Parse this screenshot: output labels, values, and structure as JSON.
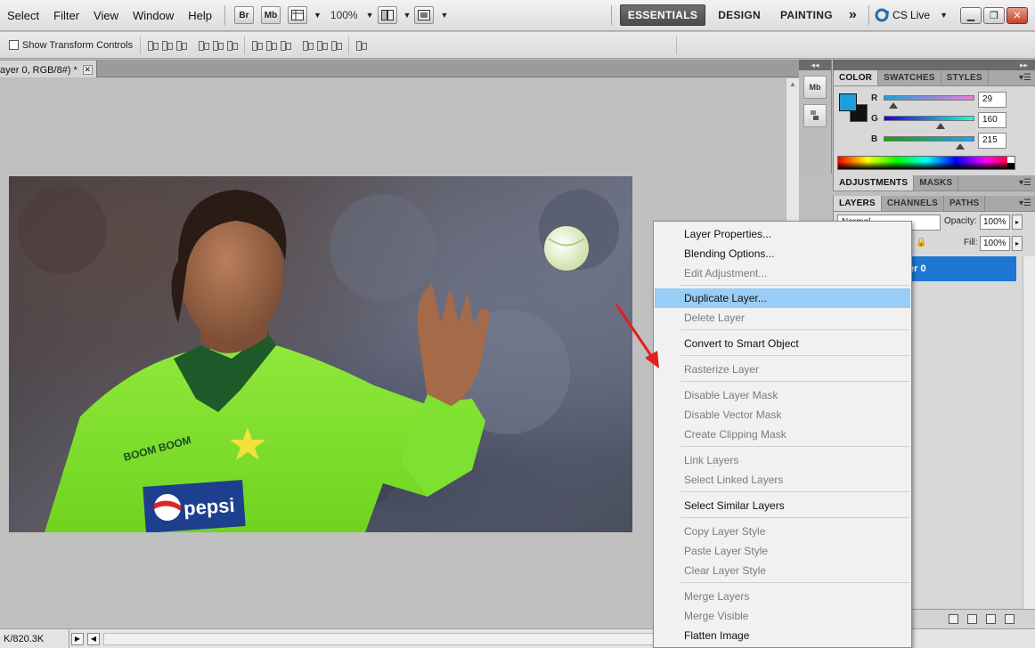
{
  "menubar": {
    "items": [
      "Select",
      "Filter",
      "View",
      "Window",
      "Help"
    ],
    "bridge_label": "Br",
    "minibridge_label": "Mb",
    "zoom": "100%",
    "workspaces": [
      "ESSENTIALS",
      "DESIGN",
      "PAINTING"
    ],
    "more": "»",
    "cslive": "CS Live"
  },
  "options": {
    "show_transform_label": "Show Transform Controls"
  },
  "document": {
    "tab_title": "ayer 0, RGB/8#) *"
  },
  "panels": {
    "color_tabs": [
      "COLOR",
      "SWATCHES",
      "STYLES"
    ],
    "color": {
      "fg": "#1da0d7",
      "r_label": "R",
      "g_label": "G",
      "b_label": "B",
      "r": "29",
      "g": "160",
      "b": "215"
    },
    "adjust_tabs": [
      "ADJUSTMENTS",
      "MASKS"
    ],
    "layers_tabs": [
      "LAYERS",
      "CHANNELS",
      "PATHS"
    ],
    "layers": {
      "blend_mode": "Normal",
      "opacity_label": "Opacity:",
      "opacity": "100%",
      "fill_label": "Fill:",
      "fill": "100%",
      "layer_name": "er 0"
    }
  },
  "context_menu": {
    "items": [
      {
        "label": "Layer Properties...",
        "state": "enabled"
      },
      {
        "label": "Blending Options...",
        "state": "enabled"
      },
      {
        "label": "Edit Adjustment...",
        "state": "disabled"
      },
      {
        "label": "Duplicate Layer...",
        "state": "highlight"
      },
      {
        "label": "Delete Layer",
        "state": "disabled"
      },
      {
        "label": "Convert to Smart Object",
        "state": "enabled"
      },
      {
        "label": "Rasterize Layer",
        "state": "disabled"
      },
      {
        "label": "Disable Layer Mask",
        "state": "disabled"
      },
      {
        "label": "Disable Vector Mask",
        "state": "disabled"
      },
      {
        "label": "Create Clipping Mask",
        "state": "disabled"
      },
      {
        "label": "Link Layers",
        "state": "disabled"
      },
      {
        "label": "Select Linked Layers",
        "state": "disabled"
      },
      {
        "label": "Select Similar Layers",
        "state": "enabled"
      },
      {
        "label": "Copy Layer Style",
        "state": "disabled"
      },
      {
        "label": "Paste Layer Style",
        "state": "disabled"
      },
      {
        "label": "Clear Layer Style",
        "state": "disabled"
      },
      {
        "label": "Merge Layers",
        "state": "disabled"
      },
      {
        "label": "Merge Visible",
        "state": "disabled"
      },
      {
        "label": "Flatten Image",
        "state": "enabled"
      }
    ]
  },
  "photo": {
    "boom_text": "BOOM BOOM",
    "sponsor": "pepsi"
  },
  "status": {
    "doc_size": "K/820.3K"
  }
}
